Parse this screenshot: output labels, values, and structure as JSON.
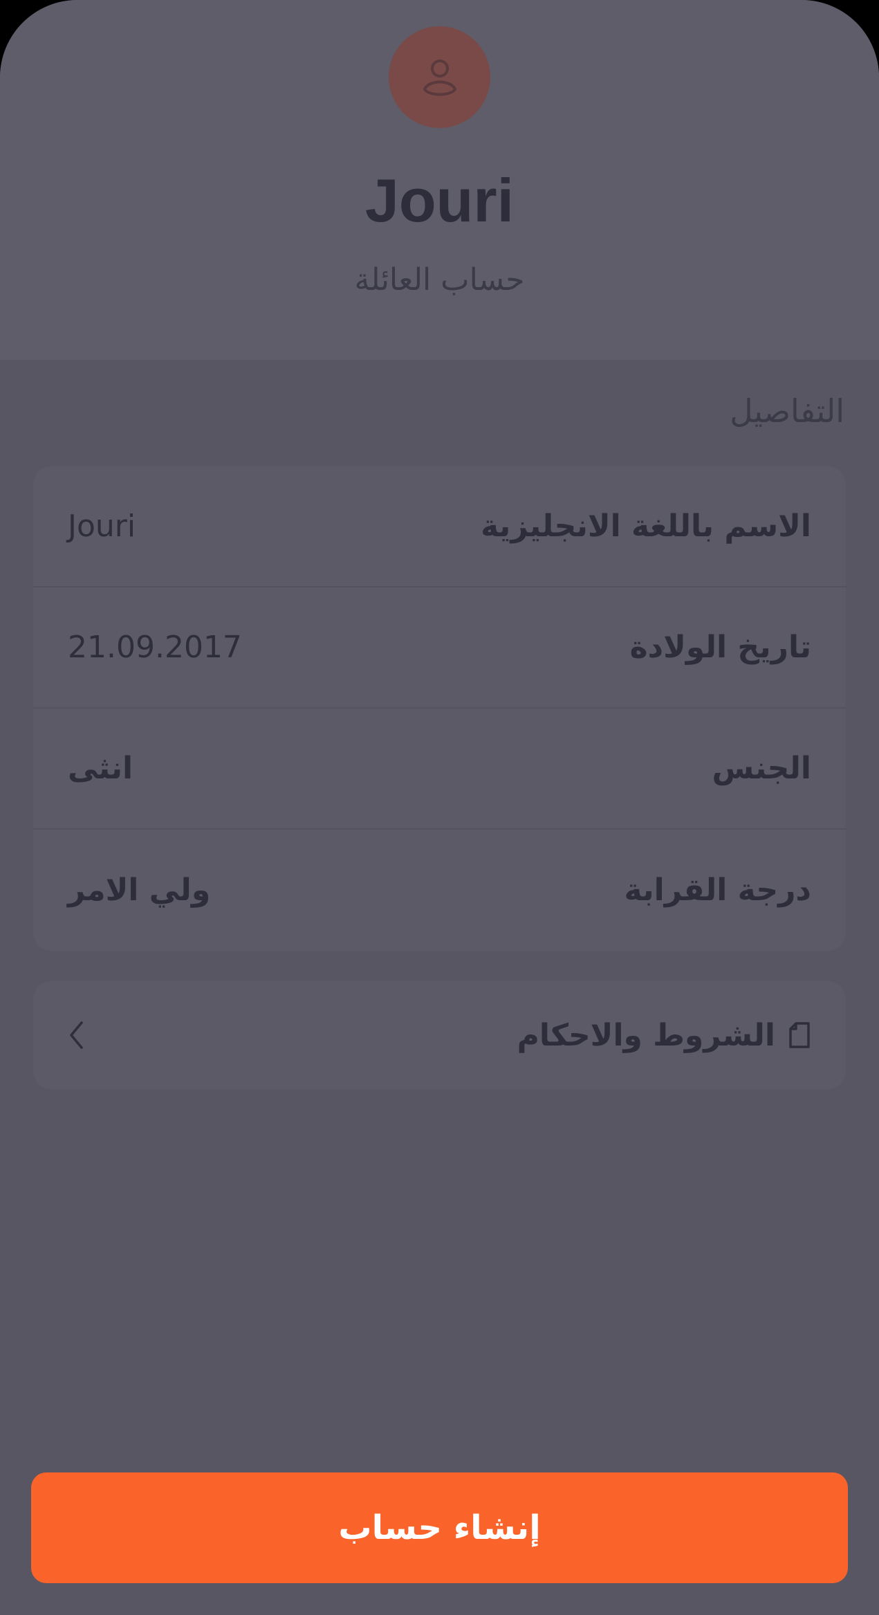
{
  "profile": {
    "name": "Jouri",
    "subtitle": "حساب العائلة",
    "avatar_icon": "user-icon"
  },
  "details": {
    "section_title": "التفاصيل",
    "rows": [
      {
        "label": "الاسم باللغة الانجليزية",
        "value": "Jouri"
      },
      {
        "label": "تاريخ الولادة",
        "value": "21.09.2017"
      },
      {
        "label": "الجنس",
        "value": "انثى"
      },
      {
        "label": "درجة القرابة",
        "value": "ولي الامر"
      }
    ]
  },
  "terms": {
    "label": "الشروط والاحكام",
    "icon": "document-icon",
    "chevron_icon": "chevron-left-icon"
  },
  "actions": {
    "create_account_label": "إنشاء حساب"
  },
  "colors": {
    "accent": "#fa642a",
    "avatar_bg": "#7a4a48",
    "overlay_bg": "#575662",
    "text_dark": "#2e2d3b"
  }
}
